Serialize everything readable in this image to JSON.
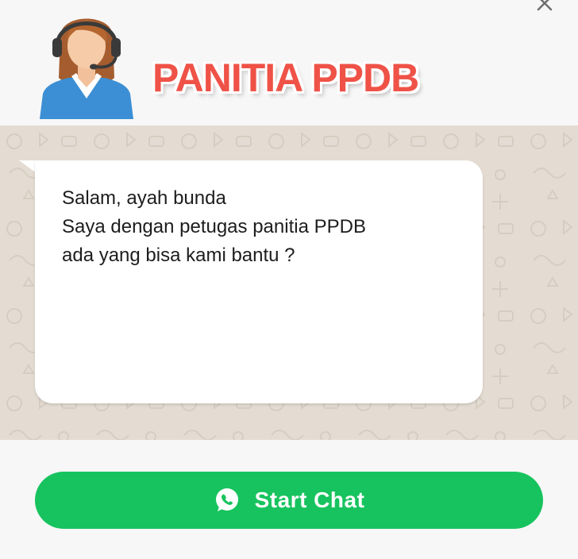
{
  "header": {
    "title": "PANITIA PPDB",
    "avatar_icon": "customer-service-agent-icon",
    "close_icon": "close-icon"
  },
  "message": {
    "lines": [
      "Salam, ayah bunda",
      "Saya dengan petugas panitia PPDB",
      "ada yang bisa kami bantu ?"
    ]
  },
  "action": {
    "start_label": "Start Chat",
    "icon": "whatsapp-icon"
  },
  "colors": {
    "title": "#ef5247",
    "button": "#17c35e",
    "chat_background": "#e4dcd2",
    "bubble": "#ffffff"
  }
}
